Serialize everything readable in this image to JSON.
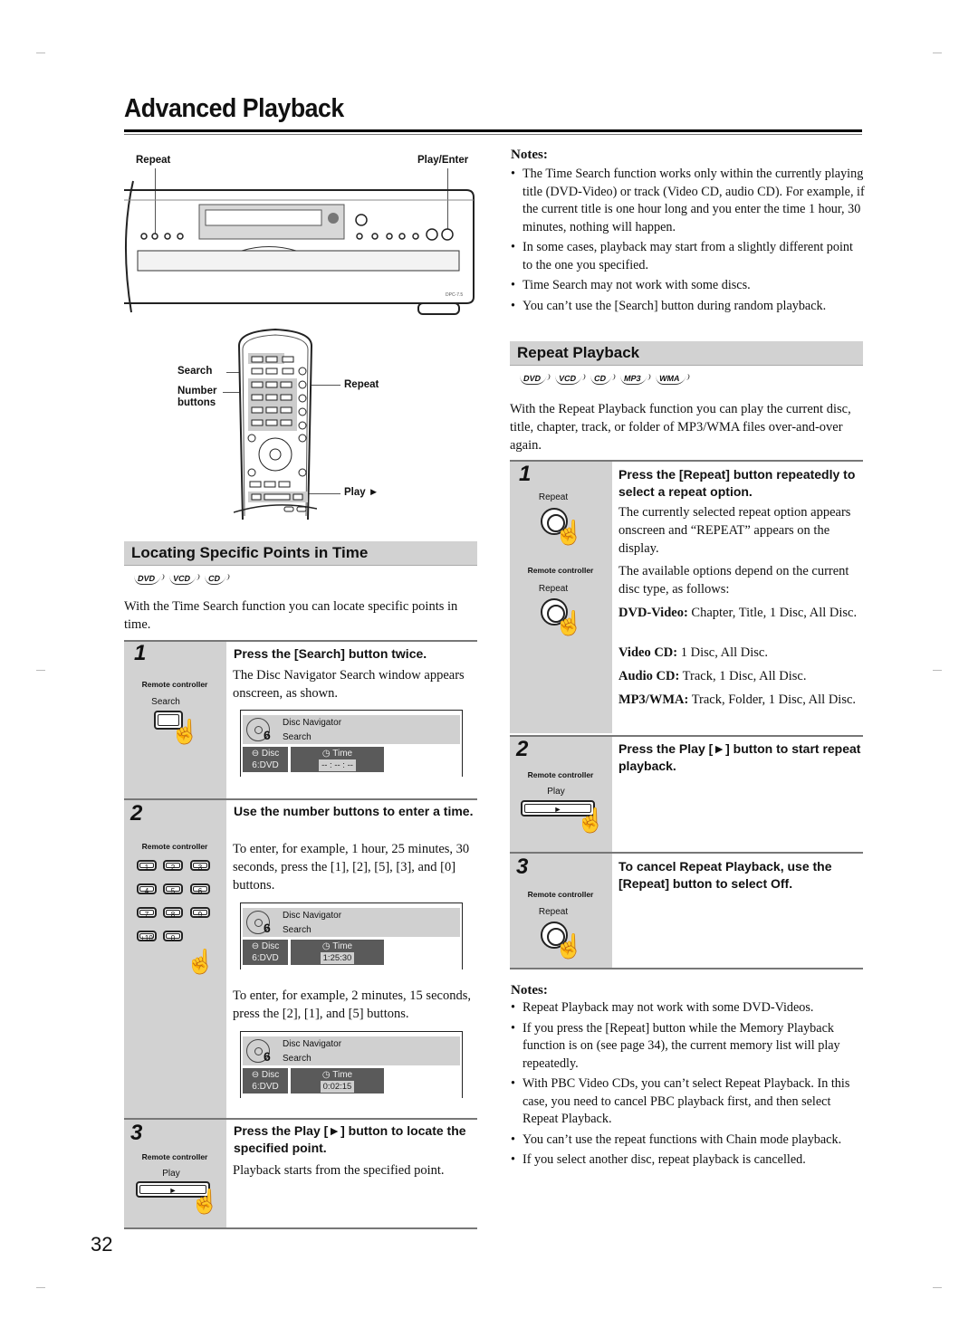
{
  "page": {
    "title": "Advanced Playback",
    "page_number": "32"
  },
  "illustrations": {
    "front_panel": {
      "callout_left": "Repeat",
      "callout_right": "Play/Enter",
      "model_label": "DPC-7.5"
    },
    "remote": {
      "callout_search": "Search",
      "callout_number_1": "Number",
      "callout_number_2": "buttons",
      "callout_repeat": "Repeat",
      "callout_play": "Play ►"
    }
  },
  "locating": {
    "heading": "Locating Specific Points in Time",
    "badges": [
      "DVD",
      "VCD",
      "CD"
    ],
    "intro": "With the Time Search function you can locate specific points in time.",
    "steps": [
      {
        "number": "1",
        "rc_label": "Remote controller",
        "button_label": "Search",
        "heading": "Press the [Search] button twice.",
        "text": "The Disc Navigator Search window appears onscreen, as shown.",
        "navigator": {
          "title": "Disc Navigator",
          "subtitle": "Search",
          "disc_no": "6",
          "disc_label": "Disc",
          "disc_value": "6:DVD",
          "time_label": "Time",
          "time_value": "-- : -- : --"
        }
      },
      {
        "number": "2",
        "rc_label": "Remote controller",
        "keypad": [
          "1",
          "2",
          "3",
          "4",
          "5",
          "6",
          "7",
          "8",
          "9",
          "+10",
          "0"
        ],
        "heading": "Use the number buttons to enter a time.",
        "text": "To enter, for example, 1 hour, 25 minutes, 30 seconds, press the [1], [2], [5], [3], and [0] buttons.",
        "navigator": {
          "title": "Disc Navigator",
          "subtitle": "Search",
          "disc_no": "6",
          "disc_label": "Disc",
          "disc_value": "6:DVD",
          "time_label": "Time",
          "time_value": "1:25:30"
        },
        "text2": "To enter, for example, 2 minutes, 15 seconds, press the [2], [1], and [5] buttons.",
        "navigator2": {
          "title": "Disc Navigator",
          "subtitle": "Search",
          "disc_no": "6",
          "disc_label": "Disc",
          "disc_value": "6:DVD",
          "time_label": "Time",
          "time_value": "0:02:15"
        }
      },
      {
        "number": "3",
        "rc_label": "Remote controller",
        "button_label": "Play",
        "heading": "Press the Play [►] button to locate the specified point.",
        "text": "Playback starts from the specified point."
      }
    ]
  },
  "notes1": {
    "title": "Notes:",
    "items": [
      "The Time Search function works only within the currently playing title (DVD-Video) or track (Video CD, audio CD). For example, if the current title is one hour long and you enter the time 1 hour, 30 minutes, nothing will happen.",
      "In some cases, playback may start from a slightly different point to the one you specified.",
      "Time Search may not work with some discs.",
      "You can’t use the [Search] button during random playback."
    ]
  },
  "repeat": {
    "heading": "Repeat Playback",
    "badges": [
      "DVD",
      "VCD",
      "CD",
      "MP3",
      "WMA"
    ],
    "intro": "With the Repeat Playback function you can play the current disc, title, chapter, track, or folder of MP3/WMA files over-and-over again.",
    "steps": [
      {
        "number": "1",
        "unit_button_label": "Repeat",
        "rc_label": "Remote controller",
        "button_label": "Repeat",
        "heading": "Press the [Repeat] button repeatedly to select a repeat option.",
        "text1": "The currently selected repeat option appears onscreen and “REPEAT” appears on the display.",
        "text2": "The available options depend on the current disc type, as follows:",
        "options": [
          {
            "type": "DVD-Video:",
            "values": "Chapter, Title, 1 Disc, All Disc."
          },
          {
            "type": "Video CD:",
            "values": "1 Disc, All Disc."
          },
          {
            "type": "Audio CD:",
            "values": "Track, 1 Disc, All Disc."
          },
          {
            "type": "MP3/WMA:",
            "values": "Track, Folder, 1 Disc, All Disc."
          }
        ]
      },
      {
        "number": "2",
        "rc_label": "Remote controller",
        "button_label": "Play",
        "heading": "Press the Play [►] button to start repeat playback."
      },
      {
        "number": "3",
        "rc_label": "Remote controller",
        "button_label": "Repeat",
        "heading": "To cancel Repeat Playback, use the [Repeat] button to select Off."
      }
    ]
  },
  "notes2": {
    "title": "Notes:",
    "items": [
      "Repeat Playback may not work with some DVD-Videos.",
      "If you press the [Repeat] button while the Memory Playback function is on (see page 34), the current memory list will play repeatedly.",
      "With PBC Video CDs, you can’t select Repeat Playback. In this case, you need to cancel PBC playback first, and then select Repeat Playback.",
      "You can’t use the repeat functions with Chain mode playback.",
      "If you select another disc, repeat playback is cancelled."
    ]
  },
  "colors": {
    "header_band": "#d2d2d2",
    "step_panel": "#d2d2d2",
    "navigator_dark": "#5a5a5a"
  }
}
